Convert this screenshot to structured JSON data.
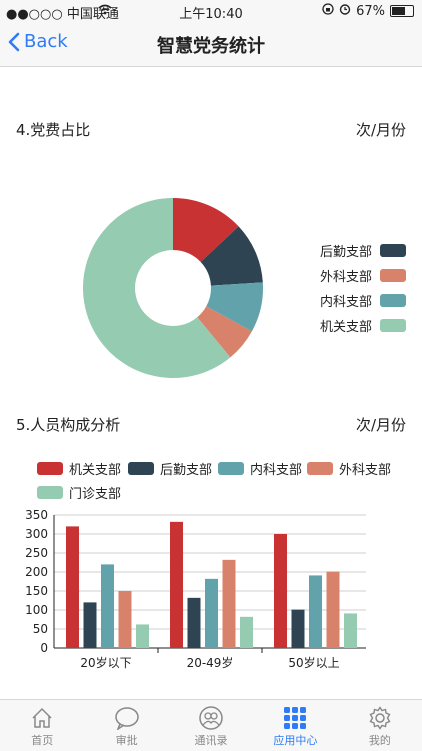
{
  "status": {
    "carrier": "●●○○○ 中国联通",
    "wifi": "wifi-icon",
    "time": "上午10:40",
    "battery": "67%"
  },
  "nav": {
    "back_label": "Back",
    "title": "智慧党务统计"
  },
  "section1": {
    "title": "4.党费占比",
    "unit": "次/月份"
  },
  "section2": {
    "title": "5.人员构成分析",
    "unit": "次/月份"
  },
  "colors": {
    "red": "#c83232",
    "navy": "#2e4453",
    "teal": "#62a3ab",
    "orange": "#d8826b",
    "mint": "#94cbb1",
    "accent": "#2f7cf6"
  },
  "chart_data": [
    {
      "type": "pie",
      "categories": [
        "后勤支部",
        "外科支部",
        "内科支部",
        "机关支部"
      ],
      "slices": [
        {
          "name": "机关支部-red",
          "value": 13,
          "color": "#c83232"
        },
        {
          "name": "后勤支部",
          "value": 11,
          "color": "#2e4453"
        },
        {
          "name": "内科支部",
          "value": 9,
          "color": "#62a3ab"
        },
        {
          "name": "外科支部",
          "value": 6,
          "color": "#d8826b"
        },
        {
          "name": "机关支部",
          "value": 61,
          "color": "#94cbb1"
        }
      ],
      "legend": [
        {
          "name": "后勤支部",
          "color": "#2e4453"
        },
        {
          "name": "外科支部",
          "color": "#d8826b"
        },
        {
          "name": "内科支部",
          "color": "#62a3ab"
        },
        {
          "name": "机关支部",
          "color": "#94cbb1"
        }
      ],
      "legend_position": "right"
    },
    {
      "type": "bar",
      "categories": [
        "20岁以下",
        "20-49岁",
        "50岁以上"
      ],
      "series": [
        {
          "name": "机关支部",
          "color": "#c83232",
          "values": [
            320,
            332,
            300
          ]
        },
        {
          "name": "后勤支部",
          "color": "#2e4453",
          "values": [
            120,
            132,
            101
          ]
        },
        {
          "name": "内科支部",
          "color": "#62a3ab",
          "values": [
            220,
            182,
            191
          ]
        },
        {
          "name": "外科支部",
          "color": "#d8826b",
          "values": [
            150,
            232,
            201
          ]
        },
        {
          "name": "门诊支部",
          "color": "#94cbb1",
          "values": [
            62,
            82,
            91
          ]
        }
      ],
      "ylim": [
        0,
        350
      ],
      "yticks": [
        0,
        50,
        100,
        150,
        200,
        250,
        300,
        350
      ],
      "grid": true,
      "legend_position": "top"
    }
  ],
  "tabs": [
    {
      "label": "首页",
      "icon": "home-icon"
    },
    {
      "label": "审批",
      "icon": "chat-icon"
    },
    {
      "label": "通讯录",
      "icon": "contacts-icon"
    },
    {
      "label": "应用中心",
      "icon": "apps-grid-icon",
      "active": true
    },
    {
      "label": "我的",
      "icon": "gear-icon"
    }
  ]
}
